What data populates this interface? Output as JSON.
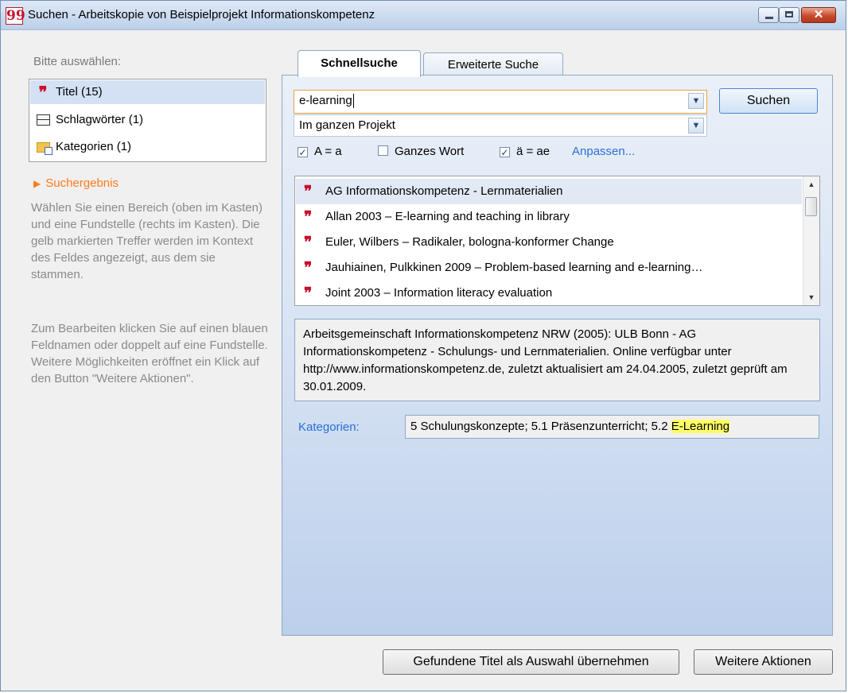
{
  "window": {
    "title": "Suchen - Arbeitskopie von Beispielprojekt Informationskompetenz",
    "app_icon": "citavi-quote-icon",
    "close_glyph": "✕"
  },
  "left": {
    "select_label": "Bitte auswählen:",
    "areas": [
      {
        "label": "Titel (15)",
        "icon": "quote-icon",
        "selected": true
      },
      {
        "label": "Schlagwörter (1)",
        "icon": "keyword-icon",
        "selected": false
      },
      {
        "label": "Kategorien (1)",
        "icon": "category-folder-icon",
        "selected": false
      }
    ],
    "result_heading": "Suchergebnis",
    "help_text_1": "Wählen Sie einen Bereich (oben im Kasten) und eine Fundstelle (rechts im Kasten). Die gelb markierten Treffer werden im Kontext des Feldes angezeigt, aus dem sie stammen.",
    "help_text_2": "Zum Bearbeiten klicken Sie auf einen blauen Feldnamen oder doppelt auf eine Fundstelle. Weitere Möglichkeiten eröffnet ein Klick auf den Button \"Weitere Aktionen\"."
  },
  "tabs": [
    {
      "label": "Schnellsuche",
      "active": true
    },
    {
      "label": "Erweiterte Suche",
      "active": false
    }
  ],
  "search": {
    "query": "e-learning",
    "scope": "Im ganzen Projekt",
    "button_label": "Suchen",
    "options": [
      {
        "label": "A = a",
        "checked": true
      },
      {
        "label": "Ganzes Wort",
        "checked": false
      },
      {
        "label": "ä = ae",
        "checked": true
      }
    ],
    "customize_link": "Anpassen..."
  },
  "results": [
    {
      "text": "AG Informationskompetenz - Lernmaterialien",
      "selected": true
    },
    {
      "text": "Allan 2003 – E-learning and teaching in library",
      "selected": false
    },
    {
      "text": "Euler, Wilbers – Radikaler, bologna-konformer Change",
      "selected": false
    },
    {
      "text": "Jauhiainen, Pulkkinen 2009 – Problem-based learning and e-learning…",
      "selected": false
    },
    {
      "text": "Joint 2003 – Information literacy evaluation",
      "selected": false
    }
  ],
  "detail": {
    "citation": "Arbeitsgemeinschaft Informationskompetenz NRW (2005): ULB Bonn - AG Informationskompetenz - Schulungs- und Lernmaterialien. Online verfügbar unter http://www.informationskompetenz.de, zuletzt aktualisiert am 24.04.2005, zuletzt geprüft am 30.01.2009.",
    "field_label": "Kategorien:",
    "field_value_prefix": "5 Schulungskonzepte; 5.1 Präsenzunterricht; 5.2 ",
    "field_value_highlight": "E-Learning"
  },
  "footer": {
    "adopt_button": "Gefundene Titel als Auswahl übernehmen",
    "more_button": "Weitere Aktionen"
  },
  "colors": {
    "accent_link": "#2a6fd6",
    "result_heading": "#ff7a1a",
    "highlight": "#ffff66",
    "quote_icon": "#c8102e"
  }
}
